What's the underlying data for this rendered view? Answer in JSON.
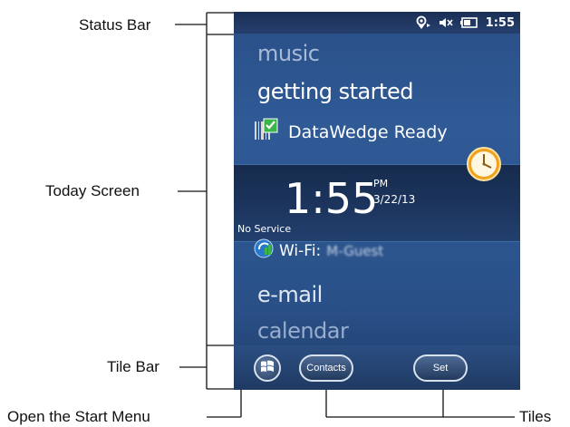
{
  "callouts": {
    "status_bar": "Status Bar",
    "today_screen": "Today Screen",
    "tile_bar": "Tile Bar",
    "open_start_menu": "Open the Start Menu",
    "tiles": "Tiles"
  },
  "status_bar": {
    "time": "1:55",
    "icons": [
      "connectivity-icon",
      "speaker-muted-icon",
      "battery-icon"
    ]
  },
  "today": {
    "music": "music",
    "getting_started": "getting started",
    "datawedge": "DataWedge Ready",
    "clock": {
      "time": "1:55",
      "ampm": "PM",
      "date": "3/22/13",
      "service": "No Service"
    },
    "wifi": {
      "label": "Wi-Fi:",
      "ssid": "M-Guest"
    },
    "email": "e-mail",
    "calendar": "calendar"
  },
  "tile_bar": {
    "start_icon": "windows-logo-icon",
    "tiles": [
      "Contacts",
      "Set"
    ]
  },
  "colors": {
    "screen_blue": "#2c5690",
    "band_dark": "#1d3660",
    "clock_orange": "#f2a21a",
    "check_green": "#3bb54a"
  }
}
